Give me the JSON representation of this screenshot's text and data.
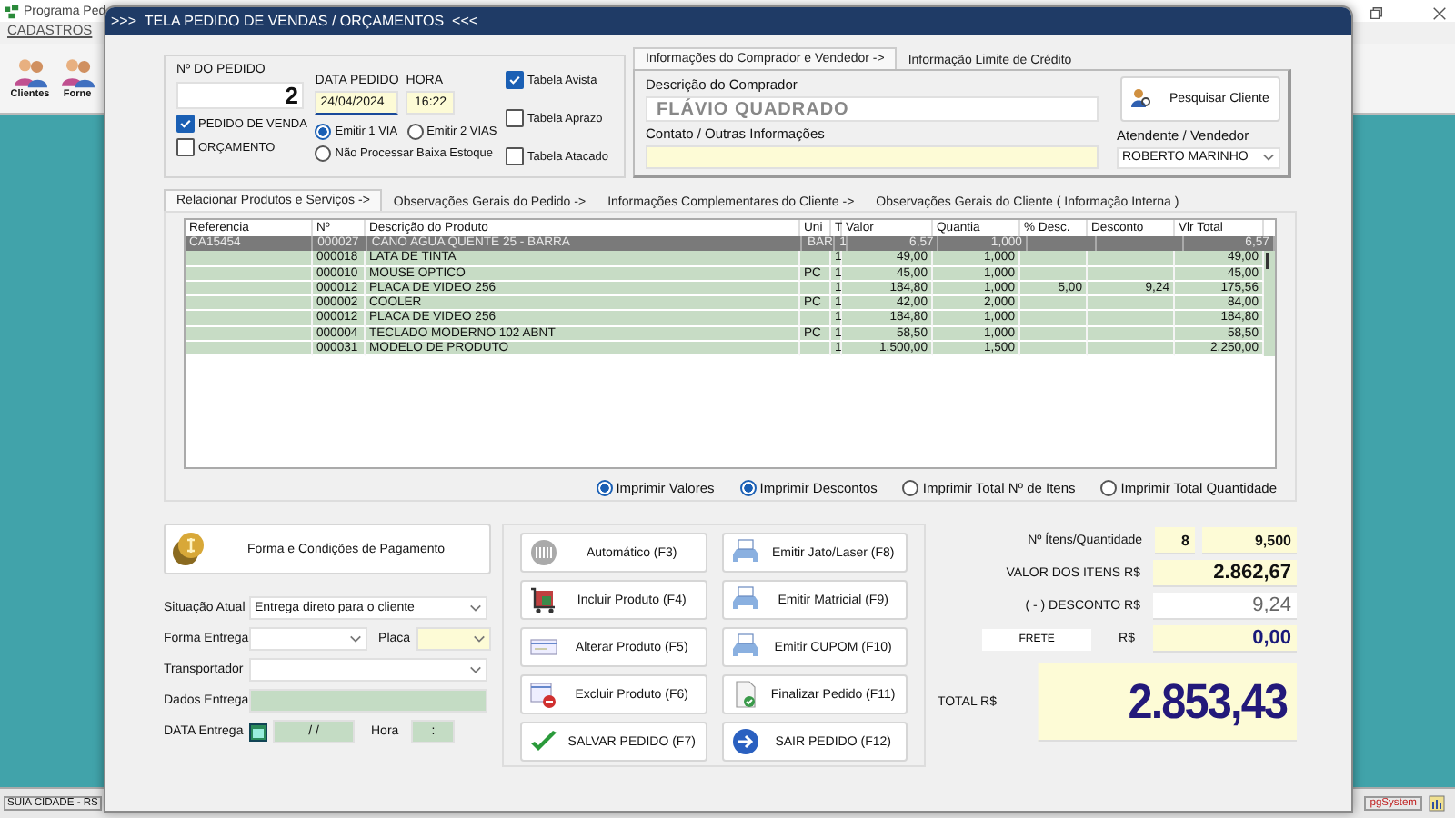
{
  "background_app": {
    "title": "Programa Ped",
    "menu": [
      "CADASTROS"
    ],
    "toolbar": [
      "Clientes",
      "Forne"
    ],
    "status_bar": [
      "SUIA CIDADE - RS",
      "pgSystem"
    ]
  },
  "dialog": {
    "title": ">>>  TELA PEDIDO DE VENDAS / ORÇAMENTOS  <<<",
    "order": {
      "number_label": "Nº DO PEDIDO",
      "number": "2",
      "date_label": "DATA PEDIDO",
      "date": "24/04/2024",
      "time_label": "HORA",
      "time": "16:22"
    },
    "order_types": [
      {
        "label": "PEDIDO DE VENDA",
        "checked": true
      },
      {
        "label": "ORÇAMENTO",
        "checked": false
      }
    ],
    "copies": [
      {
        "label": "Emitir 1 VIA",
        "selected": true
      },
      {
        "label": "Emitir 2 VIAS",
        "selected": false
      }
    ],
    "stock_option": {
      "label": "Não Processar Baixa Estoque",
      "selected": false
    },
    "price_tables": [
      {
        "label": "Tabela Avista",
        "checked": true
      },
      {
        "label": "Tabela Aprazo",
        "checked": false
      },
      {
        "label": "Tabela Atacado",
        "checked": false
      }
    ],
    "buyer_tabs": [
      {
        "label": "Informações do Comprador e Vendedor ->",
        "selected": true
      },
      {
        "label": "Informação Limite de Crédito",
        "selected": false
      }
    ],
    "buyer": {
      "name_label": "Descrição do Comprador",
      "name": "FLÁVIO QUADRADO",
      "contact_label": "Contato / Outras Informações",
      "seller_label": "Atendente / Vendedor",
      "seller": "ROBERTO MARINHO",
      "search_button": "Pesquisar Cliente"
    },
    "main_tabs": [
      {
        "label": "Relacionar Produtos e Serviços ->",
        "selected": true
      },
      {
        "label": "Observações Gerais do Pedido ->",
        "selected": false
      },
      {
        "label": "Informações Complementares do Cliente ->",
        "selected": false
      },
      {
        "label": "Observações Gerais do Cliente ( Informação Interna )",
        "selected": false
      }
    ],
    "table": {
      "columns": [
        "Referencia",
        "Nº",
        "Descrição do Produto",
        "Uni",
        "T",
        "Valor",
        "Quantia",
        "% Desc.",
        "Desconto",
        "Vlr Total"
      ],
      "rows": [
        {
          "selected": true,
          "cells": [
            "CA15454",
            "000027",
            "CANO AGUA QUENTE 25 - BARRA",
            "BAR",
            "1",
            "6,57",
            "1,000",
            "",
            "",
            "6,57"
          ]
        },
        {
          "selected": false,
          "cells": [
            "",
            "000018",
            "LATA DE TINTA",
            "",
            "1",
            "49,00",
            "1,000",
            "",
            "",
            "49,00"
          ]
        },
        {
          "selected": false,
          "cells": [
            "",
            "000010",
            "MOUSE OPTICO",
            "PC",
            "1",
            "45,00",
            "1,000",
            "",
            "",
            "45,00"
          ]
        },
        {
          "selected": false,
          "cells": [
            "",
            "000012",
            "PLACA DE VIDEO 256",
            "",
            "1",
            "184,80",
            "1,000",
            "5,00",
            "9,24",
            "175,56"
          ]
        },
        {
          "selected": false,
          "cells": [
            "",
            "000002",
            "COOLER",
            "PC",
            "1",
            "42,00",
            "2,000",
            "",
            "",
            "84,00"
          ]
        },
        {
          "selected": false,
          "cells": [
            "",
            "000012",
            "PLACA DE VIDEO 256",
            "",
            "1",
            "184,80",
            "1,000",
            "",
            "",
            "184,80"
          ]
        },
        {
          "selected": false,
          "cells": [
            "",
            "000004",
            "TECLADO MODERNO 102 ABNT",
            "PC",
            "1",
            "58,50",
            "1,000",
            "",
            "",
            "58,50"
          ]
        },
        {
          "selected": false,
          "cells": [
            "",
            "000031",
            "MODELO DE PRODUTO",
            "",
            "1",
            "1.500,00",
            "1,500",
            "",
            "",
            "2.250,00"
          ]
        }
      ]
    },
    "print_options": [
      {
        "label": "Imprimir Valores",
        "selected": true
      },
      {
        "label": "Imprimir Descontos",
        "selected": true
      },
      {
        "label": "Imprimir Total Nº de Itens",
        "selected": false
      },
      {
        "label": "Imprimir Total Quantidade",
        "selected": false
      }
    ],
    "payment_button": "Forma e Condições de Pagamento",
    "delivery": {
      "status_label": "Situação Atual",
      "status": "Entrega direto para o cliente",
      "method_label": "Forma Entrega",
      "plate_label": "Placa",
      "carrier_label": "Transportador",
      "data_label": "Dados Entrega",
      "date_label": "DATA Entrega",
      "date": " / /",
      "time_label": "Hora",
      "time": ":"
    },
    "actions": [
      {
        "label": "Automático   (F3)"
      },
      {
        "label": "Emitir Jato/Laser (F8)"
      },
      {
        "label": "Incluir Produto  (F4)"
      },
      {
        "label": "Emitir Matricial  (F9)"
      },
      {
        "label": "Alterar Produto  (F5)"
      },
      {
        "label": "Emitir CUPOM   (F10)"
      },
      {
        "label": "Excluir Produto  (F6)"
      },
      {
        "label": "Finalizar Pedido  (F11)"
      },
      {
        "label": "SALVAR PEDIDO (F7)"
      },
      {
        "label": "SAIR  PEDIDO  (F12)"
      }
    ],
    "totals": {
      "items_label": "Nº Ítens/Quantidade",
      "items": "8",
      "quantity": "9,500",
      "value_label": "VALOR DOS ITENS R$",
      "value": "2.862,67",
      "discount_label": "( - ) DESCONTO R$",
      "discount": "9,24",
      "freight_button": "FRETE",
      "freight_label": "R$",
      "freight": "0,00",
      "total_label": "TOTAL R$",
      "total": "2.853,43"
    }
  }
}
